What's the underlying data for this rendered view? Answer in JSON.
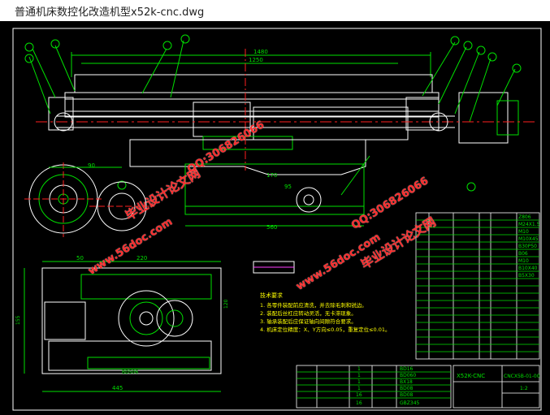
{
  "window": {
    "title": "普通机床数控化改造机型x52k-cnc.dwg"
  },
  "drawing": {
    "dims": {
      "top_length": "1480",
      "second_length": "1250",
      "middle_width": "560",
      "small_170": "170",
      "small_95": "95",
      "left_50": "50",
      "left_220": "220",
      "bottom_445": "445",
      "dim_90": "90",
      "dim_120": "120",
      "dim_155": "155",
      "label_b": "BD506"
    },
    "tech_notes": {
      "heading": "技术要求",
      "items": [
        "1. 各零件装配前应清洗，并去除毛刺和锐边。",
        "2. 装配后丝杠应转动灵活，无卡滞现象。",
        "3. 轴承装配后应保证轴向间隙符合要求。",
        "4. 机床定位精度：X、Y方向≤0.05，重复定位≤0.01。"
      ]
    },
    "title_block": {
      "code": "X52K-CNC",
      "drawing_no": "CNCX5B-01-00",
      "scale": "1:2"
    },
    "parts_small": [
      [
        "BD16",
        "1"
      ],
      [
        "BD060",
        "1"
      ],
      [
        "BX18",
        "1"
      ],
      [
        "BD08",
        "1"
      ],
      [
        "BD08",
        "16"
      ],
      [
        "GBZ345",
        "16"
      ]
    ],
    "parts_right": [
      [
        "Z806",
        ""
      ],
      [
        "M24X1.5",
        ""
      ],
      [
        "M10",
        ""
      ],
      [
        "M10X45",
        ""
      ],
      [
        "B30P50",
        ""
      ],
      [
        "B06",
        ""
      ],
      [
        "M10",
        ""
      ],
      [
        "B10X40",
        ""
      ],
      [
        "B5X30",
        ""
      ]
    ]
  },
  "watermarks": {
    "site": "www.56doc.com",
    "qq": "QQ:306826066",
    "brand": "毕业设计论文网"
  },
  "colors": {
    "background": "#000000",
    "primary_line": "#00e000",
    "white_line": "#ffffff",
    "yellow_text": "#ffff00",
    "red_center": "#ff2020",
    "magenta": "#ff40ff",
    "watermark": "#ff2b2b"
  }
}
